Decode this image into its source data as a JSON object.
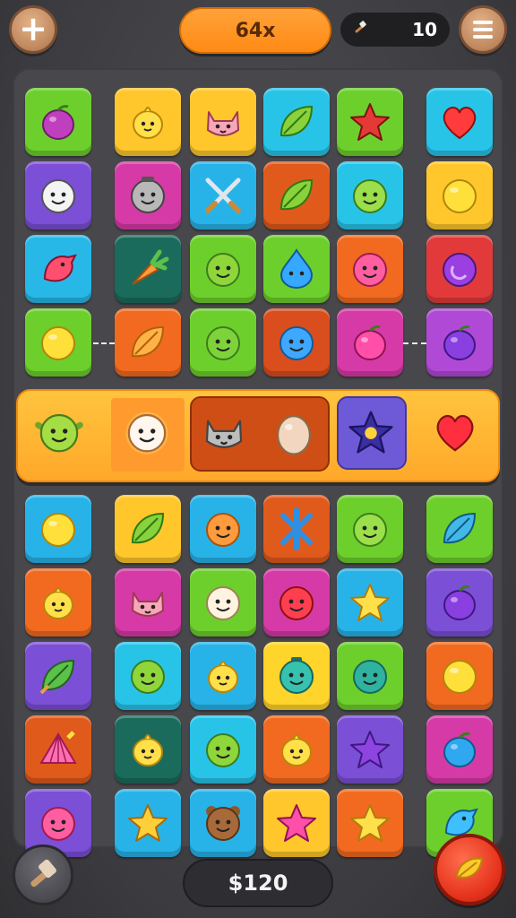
{
  "header": {
    "add_button": "+",
    "score": "64x",
    "moves_icon": "hammer-icon",
    "moves": "10",
    "menu_button": "menu-icon"
  },
  "board": {
    "row_1": [
      {
        "color": "#6dcf2c",
        "icon": "plum"
      },
      {
        "color": "#ffc72b",
        "icon": "chick-face"
      },
      {
        "color": "#ffc72b",
        "icon": "pink-cat-face"
      },
      {
        "color": "#28c4e8",
        "icon": "green-leaf"
      },
      {
        "color": "#6dcf2c",
        "icon": "red-star"
      },
      {
        "color": "#28c4e8",
        "icon": "heart"
      }
    ],
    "row_2": [
      {
        "color": "#7b4fd6",
        "icon": "white-bear-face"
      },
      {
        "color": "#d63aa6",
        "icon": "grey-robot-face"
      },
      {
        "color": "#28b3e8",
        "icon": "crossed-swords"
      },
      {
        "color": "#e05a1c",
        "icon": "lime"
      },
      {
        "color": "#28c4e8",
        "icon": "green-monster-face"
      },
      {
        "color": "#ffc72b",
        "icon": "yellow-ball"
      }
    ],
    "row_3": [
      {
        "color": "#28b8e8",
        "icon": "red-bird"
      },
      {
        "color": "#1b6b5c",
        "icon": "orange-carrot"
      },
      {
        "color": "#6dcf2c",
        "icon": "green-frog-face"
      },
      {
        "color": "#6dcf2c",
        "icon": "blue-drop-face"
      },
      {
        "color": "#f26a1f",
        "icon": "pink-blob-face"
      },
      {
        "color": "#e23a3a",
        "icon": "purple-moon"
      }
    ],
    "row_4": [
      {
        "color": "#6dcf2c",
        "icon": "yellow-ball"
      },
      {
        "color": "#f26a1f",
        "icon": "orange-leaf"
      },
      {
        "color": "#6dcf2c",
        "icon": "green-alien-face"
      },
      {
        "color": "#d94e1c",
        "icon": "blue-fish-face"
      },
      {
        "color": "#d63aa6",
        "icon": "pink-plum"
      },
      {
        "color": "#b049d6",
        "icon": "purple-plum"
      }
    ],
    "row_5": [
      {
        "color": "#28b3e8",
        "icon": "yellow-ball"
      },
      {
        "color": "#ffc72b",
        "icon": "green-leaf"
      },
      {
        "color": "#28b3e8",
        "icon": "orange-face"
      },
      {
        "color": "#e05a1c",
        "icon": "blue-x-star"
      },
      {
        "color": "#6dcf2c",
        "icon": "green-monster-face"
      },
      {
        "color": "#6dcf2c",
        "icon": "blue-leaf"
      }
    ],
    "row_6": [
      {
        "color": "#f26a1f",
        "icon": "yellow-chick"
      },
      {
        "color": "#d63aa6",
        "icon": "pink-cat-face"
      },
      {
        "color": "#6dcf2c",
        "icon": "white-hamster-face"
      },
      {
        "color": "#d63aa6",
        "icon": "red-berry-face"
      },
      {
        "color": "#28b3e8",
        "icon": "yellow-star"
      },
      {
        "color": "#7b4fd6",
        "icon": "purple-plum"
      }
    ],
    "row_7": [
      {
        "color": "#7b4fd6",
        "icon": "green-feather"
      },
      {
        "color": "#28c4e8",
        "icon": "green-frog-face"
      },
      {
        "color": "#28b3e8",
        "icon": "yellow-chick"
      },
      {
        "color": "#ffd42b",
        "icon": "teal-bottle-face"
      },
      {
        "color": "#6dcf2c",
        "icon": "teal-ball-face"
      },
      {
        "color": "#f26a1f",
        "icon": "yellow-ball"
      }
    ],
    "row_8": [
      {
        "color": "#e05a1c",
        "icon": "pink-shell"
      },
      {
        "color": "#1b6b5c",
        "icon": "yellow-chick"
      },
      {
        "color": "#28c4e8",
        "icon": "green-face"
      },
      {
        "color": "#f26a1f",
        "icon": "yellow-chick"
      },
      {
        "color": "#7b4fd6",
        "icon": "purple-star"
      },
      {
        "color": "#d63aa6",
        "icon": "blue-plum"
      }
    ],
    "row_9": [
      {
        "color": "#7b4fd6",
        "icon": "pink-blob-face"
      },
      {
        "color": "#28b3e8",
        "icon": "yellow-star-burst"
      },
      {
        "color": "#28b3e8",
        "icon": "brown-bear-face"
      },
      {
        "color": "#ffc72b",
        "icon": "pink-star"
      },
      {
        "color": "#f26a1f",
        "icon": "yellow-star"
      },
      {
        "color": "#6dcf2c",
        "icon": "blue-bird"
      }
    ]
  },
  "highlight_strip": [
    "green-goblin-face",
    "white-sun-face",
    "grey-cat-face",
    "beige-egg",
    "rainbow-star",
    "red-heart"
  ],
  "footer": {
    "hammer_button": "hammer-icon",
    "coins": "$120",
    "boost_button": "yellow-leaf-icon"
  }
}
